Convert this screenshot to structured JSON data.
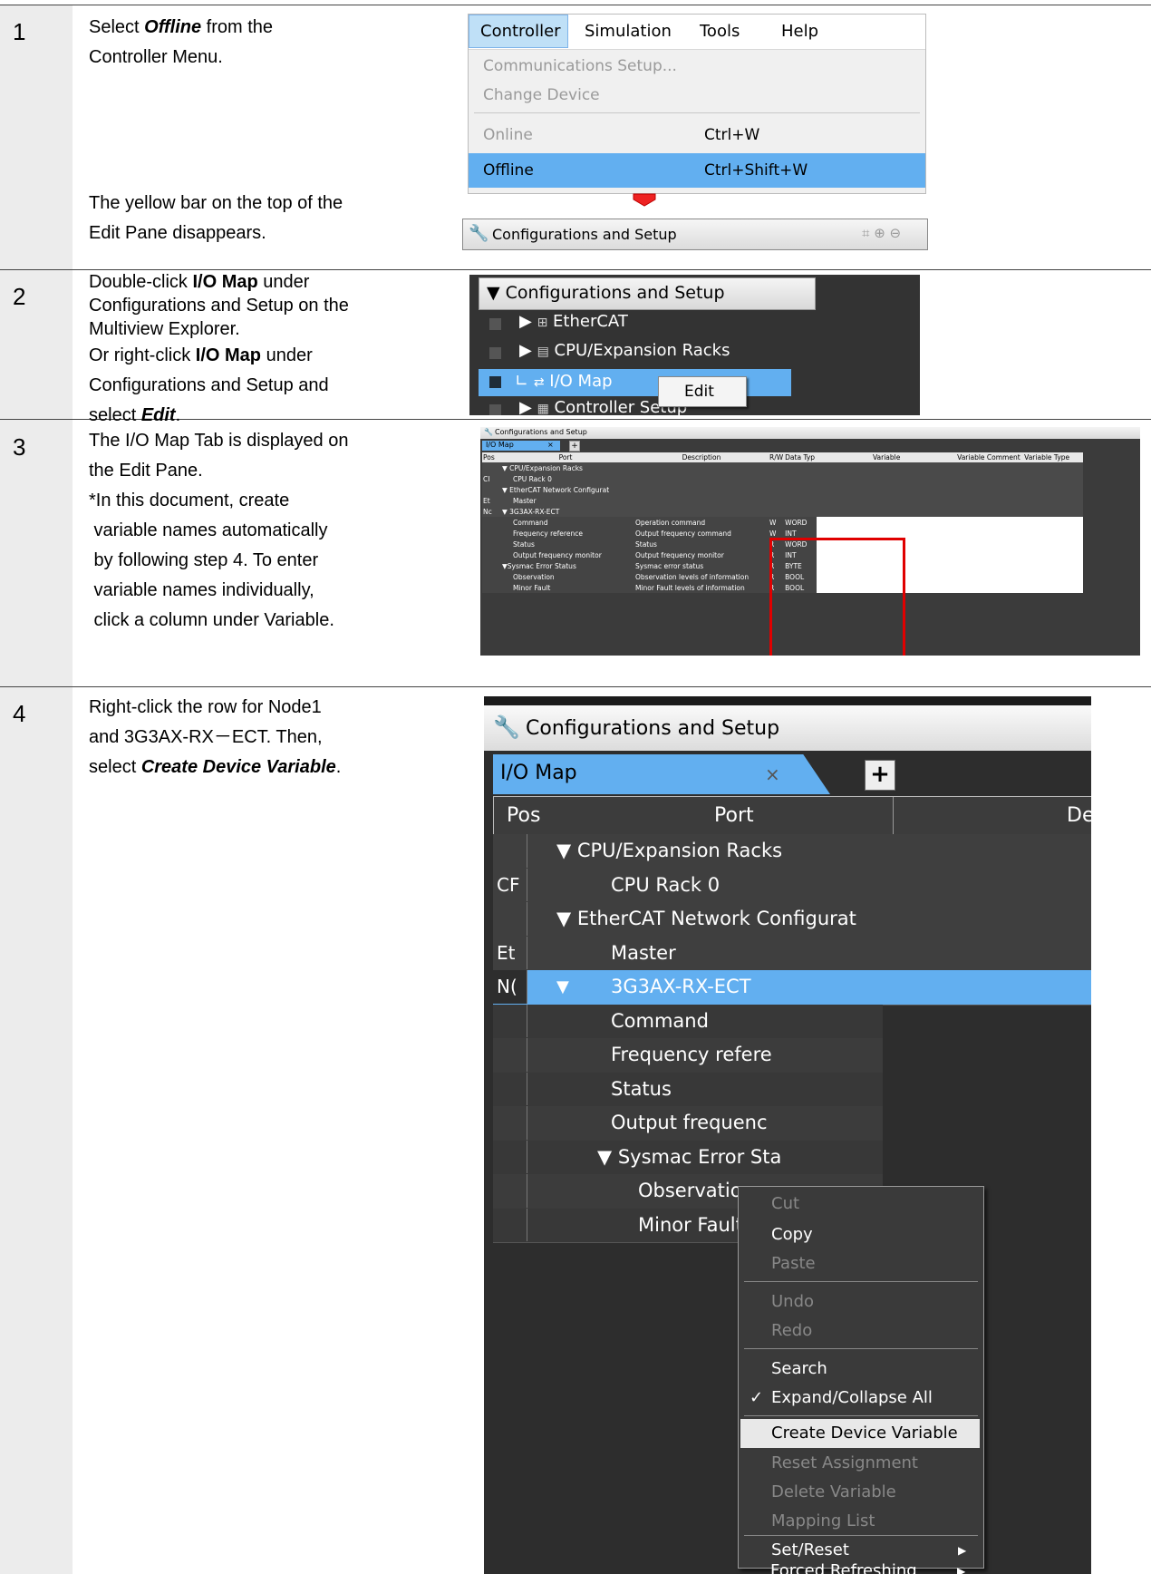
{
  "step1": {
    "number": "1",
    "instr_pre": "Select ",
    "instr_bold": "Offline",
    "instr_post1": " from the",
    "instr_line2": "Controller Menu.",
    "result_line1": "The yellow bar on the top of the",
    "result_line2": "Edit Pane disappears.",
    "menu_bar": [
      "Controller",
      "Simulation",
      "Tools",
      "Help"
    ],
    "menu_items": {
      "comm": "Communications Setup...",
      "change": "Change Device",
      "online": "Online",
      "online_sc": "Ctrl+W",
      "offline": "Offline",
      "offline_sc": "Ctrl+Shift+W"
    },
    "pane_title": "Configurations and Setup"
  },
  "step2": {
    "number": "2",
    "l1_pre": "Double-click ",
    "l1_bold": "I/O Map",
    "l1_post": " under",
    "l2": "Configurations and Setup on the",
    "l3": "Multiview Explorer.",
    "l4_pre": "Or right-click ",
    "l4_bold": "I/O Map",
    "l4_post": " under",
    "l5": "Configurations and Setup and",
    "l6_pre": "select ",
    "l6_bold": "Edit",
    "l6_post": ".",
    "tree_header": "Configurations and Setup",
    "tree_items": [
      "EtherCAT",
      "CPU/Expansion Racks",
      "I/O Map",
      "Controller Setup"
    ],
    "popup_edit": "Edit"
  },
  "step3": {
    "number": "3",
    "lines": [
      "The I/O Map Tab is displayed on",
      "the Edit Pane.",
      "*In this document, create",
      " variable names automatically",
      " by following step 4. To enter",
      " variable names individually,",
      " click a column under Variable."
    ],
    "pane_title": "Configurations and Setup",
    "tab": "I/O Map",
    "headers": [
      "Pos",
      "Port",
      "Description",
      "R/W",
      "Data Typ",
      "Variable",
      "Variable Comment",
      "Variable Type"
    ],
    "rows": [
      {
        "pos": "",
        "port": "▼ CPU/Expansion Racks",
        "desc": "",
        "rw": "",
        "dt": ""
      },
      {
        "pos": "CI",
        "port": "CPU Rack 0",
        "desc": "",
        "rw": "",
        "dt": ""
      },
      {
        "pos": "",
        "port": "▼ EtherCAT Network Configurat",
        "desc": "",
        "rw": "",
        "dt": ""
      },
      {
        "pos": "Et",
        "port": "Master",
        "desc": "",
        "rw": "",
        "dt": ""
      },
      {
        "pos": "Nc",
        "port": "▼  3G3AX-RX-ECT",
        "desc": "",
        "rw": "",
        "dt": ""
      },
      {
        "pos": "",
        "port": "Command",
        "desc": "Operation command",
        "rw": "W",
        "dt": "WORD"
      },
      {
        "pos": "",
        "port": "Frequency reference",
        "desc": "Output frequency command",
        "rw": "W",
        "dt": "INT"
      },
      {
        "pos": "",
        "port": "Status",
        "desc": "Status",
        "rw": "R",
        "dt": "WORD"
      },
      {
        "pos": "",
        "port": "Output frequency monitor",
        "desc": "Output frequency monitor",
        "rw": "R",
        "dt": "INT"
      },
      {
        "pos": "",
        "port": "▼Sysmac Error Status",
        "desc": "Sysmac error status",
        "rw": "R",
        "dt": "BYTE"
      },
      {
        "pos": "",
        "port": "Observation",
        "desc": "Observation levels of information",
        "rw": "R",
        "dt": "BOOL"
      },
      {
        "pos": "",
        "port": "Minor Fault",
        "desc": "Minor Fault levels of information",
        "rw": "R",
        "dt": "BOOL"
      }
    ]
  },
  "step4": {
    "number": "4",
    "l1": "Right-click the row for Node1",
    "l2": "and 3G3AX-RX－ECT. Then,",
    "l3_pre": "select ",
    "l3_bold": "Create Device Variable",
    "l3_post": ".",
    "pane_title": "Configurations and Setup",
    "tab": "I/O Map",
    "col_pos": "Pos",
    "col_port": "Port",
    "col_desc": "De",
    "rows": [
      {
        "pos": "",
        "port": "▼ CPU/Expansion Racks"
      },
      {
        "pos": "CF",
        "port": "CPU Rack 0"
      },
      {
        "pos": "",
        "port": "▼ EtherCAT Network Configurat"
      },
      {
        "pos": "Et",
        "port": "Master"
      },
      {
        "pos": "N(",
        "port": "3G3AX-RX-ECT"
      },
      {
        "pos": "",
        "port": "Command"
      },
      {
        "pos": "",
        "port": "Frequency refere"
      },
      {
        "pos": "",
        "port": "Status"
      },
      {
        "pos": "",
        "port": "Output frequenc"
      },
      {
        "pos": "",
        "port": "▼ Sysmac Error Sta"
      },
      {
        "pos": "",
        "port": "Observation"
      },
      {
        "pos": "",
        "port": "Minor Fault"
      }
    ],
    "context_menu": {
      "cut": "Cut",
      "copy": "Copy",
      "paste": "Paste",
      "undo": "Undo",
      "redo": "Redo",
      "search": "Search",
      "expand": "Expand/Collapse All",
      "create": "Create Device Variable",
      "reset": "Reset Assignment",
      "delete": "Delete Variable",
      "mapping": "Mapping List",
      "setreset": "Set/Reset",
      "forced": "Forced Refreshing"
    }
  },
  "colors": {
    "highlight_blue": "#70b8f0",
    "red_frame": "#e00000",
    "gutter_gray": "#ececec"
  }
}
